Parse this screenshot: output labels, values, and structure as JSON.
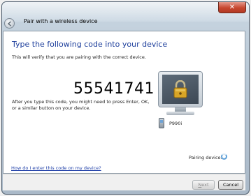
{
  "window": {
    "title": "Pair with a wireless device",
    "close_glyph": "✕",
    "back_glyph": "◀"
  },
  "main": {
    "heading": "Type the following code into your device",
    "subtext": "This will verify that you are pairing with the correct device.",
    "code": "55541741",
    "instruction": "After you type this code, you might need to press Enter, OK, or a similar button on your device.",
    "device_name": "P990i",
    "pairing_status": "Pairing device...",
    "help_link": "How do I enter this code on my device?"
  },
  "buttons": {
    "next_label": "Next",
    "cancel_label": "Cancel"
  },
  "colors": {
    "heading": "#1e3f9c",
    "link": "#1f3fa8",
    "spinner": "#5fa1d9"
  },
  "icons": {
    "lock": "lock-icon",
    "phone": "phone-icon",
    "monitor": "monitor-icon"
  }
}
